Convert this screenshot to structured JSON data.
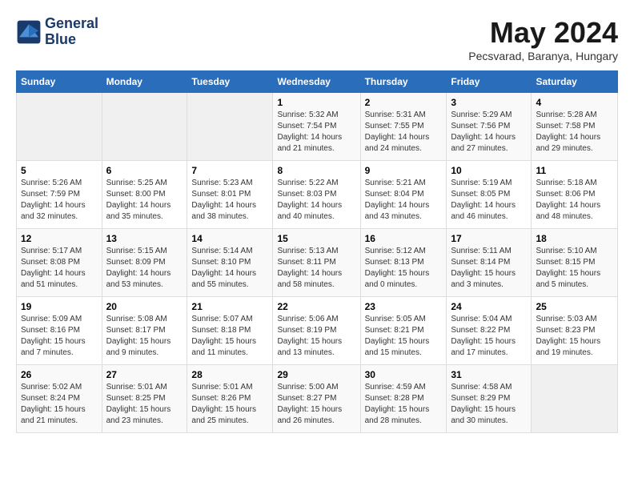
{
  "header": {
    "logo_line1": "General",
    "logo_line2": "Blue",
    "month": "May 2024",
    "location": "Pecsvarad, Baranya, Hungary"
  },
  "days_of_week": [
    "Sunday",
    "Monday",
    "Tuesday",
    "Wednesday",
    "Thursday",
    "Friday",
    "Saturday"
  ],
  "weeks": [
    [
      {
        "day": "",
        "info": ""
      },
      {
        "day": "",
        "info": ""
      },
      {
        "day": "",
        "info": ""
      },
      {
        "day": "1",
        "info": "Sunrise: 5:32 AM\nSunset: 7:54 PM\nDaylight: 14 hours\nand 21 minutes."
      },
      {
        "day": "2",
        "info": "Sunrise: 5:31 AM\nSunset: 7:55 PM\nDaylight: 14 hours\nand 24 minutes."
      },
      {
        "day": "3",
        "info": "Sunrise: 5:29 AM\nSunset: 7:56 PM\nDaylight: 14 hours\nand 27 minutes."
      },
      {
        "day": "4",
        "info": "Sunrise: 5:28 AM\nSunset: 7:58 PM\nDaylight: 14 hours\nand 29 minutes."
      }
    ],
    [
      {
        "day": "5",
        "info": "Sunrise: 5:26 AM\nSunset: 7:59 PM\nDaylight: 14 hours\nand 32 minutes."
      },
      {
        "day": "6",
        "info": "Sunrise: 5:25 AM\nSunset: 8:00 PM\nDaylight: 14 hours\nand 35 minutes."
      },
      {
        "day": "7",
        "info": "Sunrise: 5:23 AM\nSunset: 8:01 PM\nDaylight: 14 hours\nand 38 minutes."
      },
      {
        "day": "8",
        "info": "Sunrise: 5:22 AM\nSunset: 8:03 PM\nDaylight: 14 hours\nand 40 minutes."
      },
      {
        "day": "9",
        "info": "Sunrise: 5:21 AM\nSunset: 8:04 PM\nDaylight: 14 hours\nand 43 minutes."
      },
      {
        "day": "10",
        "info": "Sunrise: 5:19 AM\nSunset: 8:05 PM\nDaylight: 14 hours\nand 46 minutes."
      },
      {
        "day": "11",
        "info": "Sunrise: 5:18 AM\nSunset: 8:06 PM\nDaylight: 14 hours\nand 48 minutes."
      }
    ],
    [
      {
        "day": "12",
        "info": "Sunrise: 5:17 AM\nSunset: 8:08 PM\nDaylight: 14 hours\nand 51 minutes."
      },
      {
        "day": "13",
        "info": "Sunrise: 5:15 AM\nSunset: 8:09 PM\nDaylight: 14 hours\nand 53 minutes."
      },
      {
        "day": "14",
        "info": "Sunrise: 5:14 AM\nSunset: 8:10 PM\nDaylight: 14 hours\nand 55 minutes."
      },
      {
        "day": "15",
        "info": "Sunrise: 5:13 AM\nSunset: 8:11 PM\nDaylight: 14 hours\nand 58 minutes."
      },
      {
        "day": "16",
        "info": "Sunrise: 5:12 AM\nSunset: 8:13 PM\nDaylight: 15 hours\nand 0 minutes."
      },
      {
        "day": "17",
        "info": "Sunrise: 5:11 AM\nSunset: 8:14 PM\nDaylight: 15 hours\nand 3 minutes."
      },
      {
        "day": "18",
        "info": "Sunrise: 5:10 AM\nSunset: 8:15 PM\nDaylight: 15 hours\nand 5 minutes."
      }
    ],
    [
      {
        "day": "19",
        "info": "Sunrise: 5:09 AM\nSunset: 8:16 PM\nDaylight: 15 hours\nand 7 minutes."
      },
      {
        "day": "20",
        "info": "Sunrise: 5:08 AM\nSunset: 8:17 PM\nDaylight: 15 hours\nand 9 minutes."
      },
      {
        "day": "21",
        "info": "Sunrise: 5:07 AM\nSunset: 8:18 PM\nDaylight: 15 hours\nand 11 minutes."
      },
      {
        "day": "22",
        "info": "Sunrise: 5:06 AM\nSunset: 8:19 PM\nDaylight: 15 hours\nand 13 minutes."
      },
      {
        "day": "23",
        "info": "Sunrise: 5:05 AM\nSunset: 8:21 PM\nDaylight: 15 hours\nand 15 minutes."
      },
      {
        "day": "24",
        "info": "Sunrise: 5:04 AM\nSunset: 8:22 PM\nDaylight: 15 hours\nand 17 minutes."
      },
      {
        "day": "25",
        "info": "Sunrise: 5:03 AM\nSunset: 8:23 PM\nDaylight: 15 hours\nand 19 minutes."
      }
    ],
    [
      {
        "day": "26",
        "info": "Sunrise: 5:02 AM\nSunset: 8:24 PM\nDaylight: 15 hours\nand 21 minutes."
      },
      {
        "day": "27",
        "info": "Sunrise: 5:01 AM\nSunset: 8:25 PM\nDaylight: 15 hours\nand 23 minutes."
      },
      {
        "day": "28",
        "info": "Sunrise: 5:01 AM\nSunset: 8:26 PM\nDaylight: 15 hours\nand 25 minutes."
      },
      {
        "day": "29",
        "info": "Sunrise: 5:00 AM\nSunset: 8:27 PM\nDaylight: 15 hours\nand 26 minutes."
      },
      {
        "day": "30",
        "info": "Sunrise: 4:59 AM\nSunset: 8:28 PM\nDaylight: 15 hours\nand 28 minutes."
      },
      {
        "day": "31",
        "info": "Sunrise: 4:58 AM\nSunset: 8:29 PM\nDaylight: 15 hours\nand 30 minutes."
      },
      {
        "day": "",
        "info": ""
      }
    ]
  ]
}
